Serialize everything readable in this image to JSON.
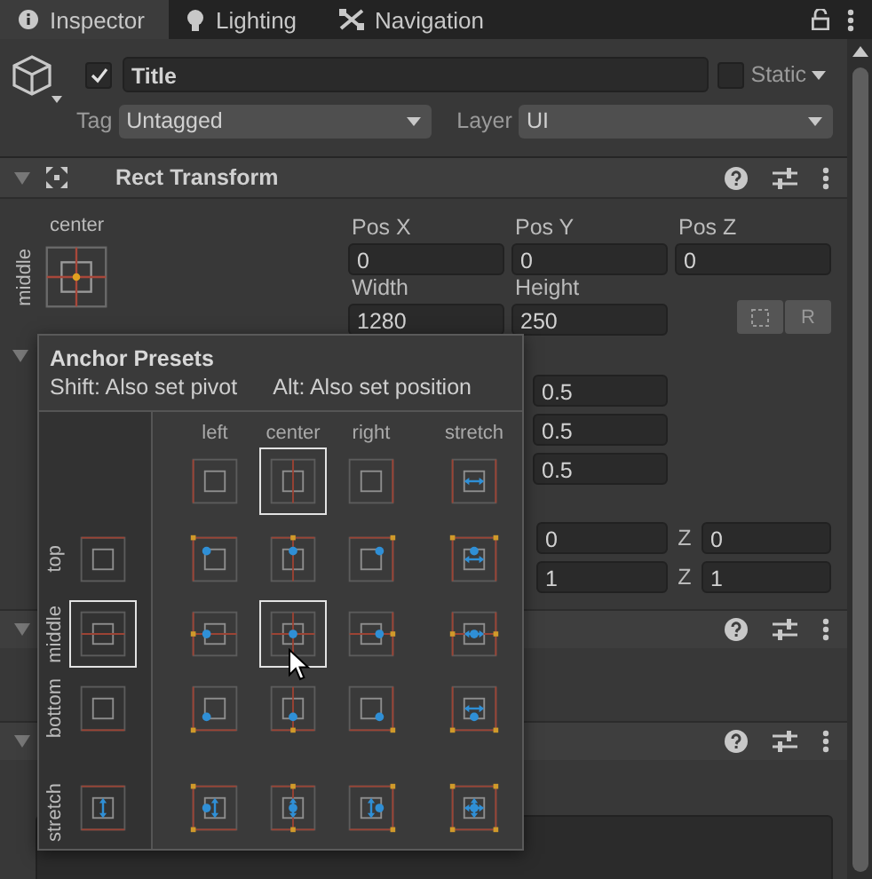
{
  "tabs": [
    {
      "label": "Inspector",
      "kind": "info",
      "selected": true
    },
    {
      "label": "Lighting",
      "kind": "bulb",
      "selected": false
    },
    {
      "label": "Navigation",
      "kind": "nav",
      "selected": false
    }
  ],
  "object": {
    "active": true,
    "name": "Title",
    "static": false,
    "static_label": "Static",
    "tag_label": "Tag",
    "tag": "Untagged",
    "layer_label": "Layer",
    "layer": "UI"
  },
  "rect_transform": {
    "title": "Rect Transform",
    "expanded": true,
    "anchor_h": "center",
    "anchor_v": "middle",
    "fields": [
      {
        "label": "Pos X",
        "value": "0"
      },
      {
        "label": "Pos Y",
        "value": "0"
      },
      {
        "label": "Pos Z",
        "value": "0"
      },
      {
        "label": "Width",
        "value": "1280"
      },
      {
        "label": "Height",
        "value": "250"
      }
    ],
    "r_button": "R",
    "anchors_expanded": true,
    "anchor_values": [
      "0.5",
      "0.5",
      "0.5"
    ],
    "vector_rows": [
      {
        "value": "0",
        "z_label": "Z",
        "z_value": "0"
      },
      {
        "value": "1",
        "z_label": "Z",
        "z_value": "1"
      }
    ]
  },
  "components": [
    {
      "expanded": true
    },
    {
      "expanded": true
    }
  ],
  "anchor_presets": {
    "title": "Anchor Presets",
    "hint_shift": "Shift: Also set pivot",
    "hint_alt": "Alt: Also set position",
    "columns": [
      {
        "label": "left",
        "kind": "left",
        "selected": false
      },
      {
        "label": "center",
        "kind": "center",
        "selected": true
      },
      {
        "label": "right",
        "kind": "right",
        "selected": false
      },
      {
        "label": "stretch",
        "kind": "stretch",
        "selected": false
      }
    ],
    "rows": [
      {
        "label": "top",
        "kind": "top",
        "selected": false,
        "cells": [
          {
            "selected": false
          },
          {
            "selected": false
          },
          {
            "selected": false
          },
          {
            "selected": false
          }
        ]
      },
      {
        "label": "middle",
        "kind": "middle",
        "selected": true,
        "cells": [
          {
            "selected": false
          },
          {
            "selected": true
          },
          {
            "selected": false
          },
          {
            "selected": false
          }
        ]
      },
      {
        "label": "bottom",
        "kind": "bottom",
        "selected": false,
        "cells": [
          {
            "selected": false
          },
          {
            "selected": false
          },
          {
            "selected": false
          },
          {
            "selected": false
          }
        ]
      },
      {
        "label": "stretch",
        "kind": "stretch",
        "selected": false,
        "cells": [
          {
            "selected": false
          },
          {
            "selected": false
          },
          {
            "selected": false
          },
          {
            "selected": false
          }
        ]
      }
    ]
  }
}
